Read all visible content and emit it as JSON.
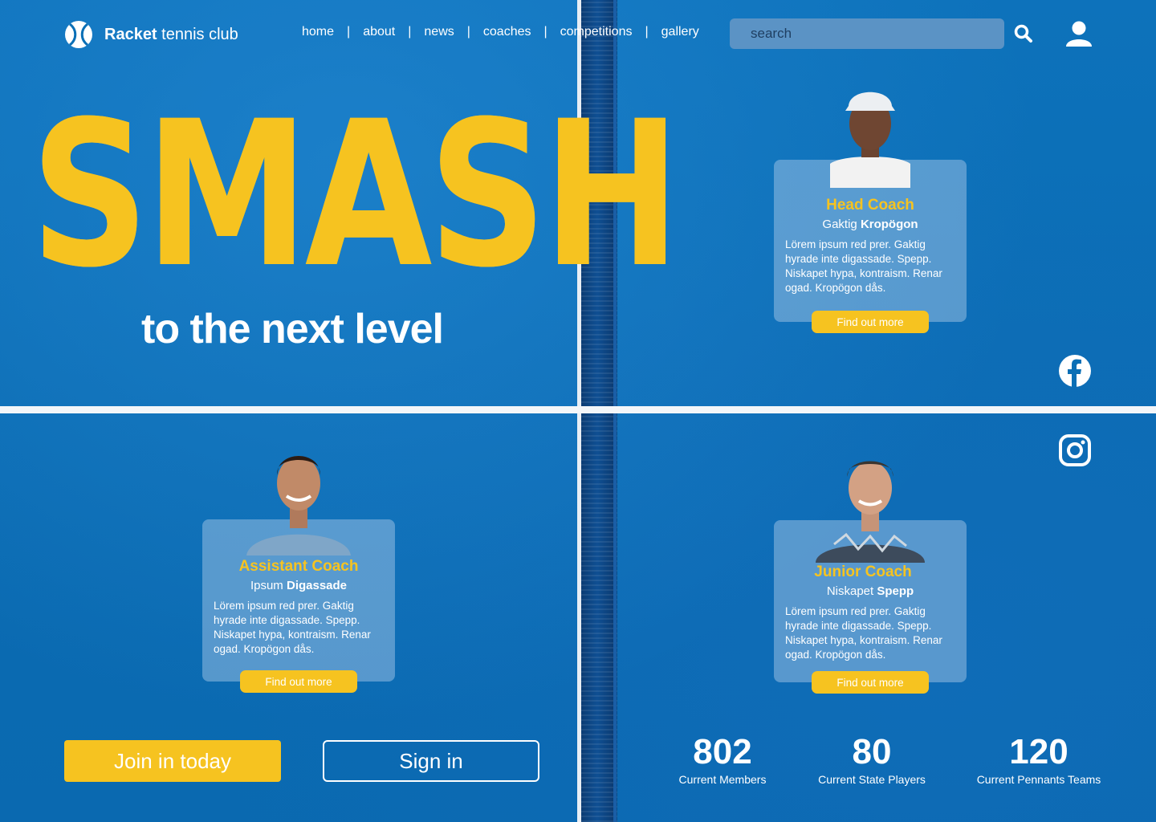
{
  "header": {
    "logo_bold": "Racket",
    "logo_rest": " tennis club",
    "nav": [
      "home",
      "about",
      "news",
      "coaches",
      "competitions",
      "gallery"
    ],
    "search_placeholder": "search"
  },
  "hero": {
    "headline": "SMASH",
    "tagline": "to the next level"
  },
  "coaches": [
    {
      "role": "Head Coach",
      "first": "Gaktig",
      "last": "Kropögon",
      "bio": "Lörem ipsum red prer. Gaktig hyrade inte digassade. Spepp. Niskapet hypa, kontraism. Renar ogad. Kropögon dås.",
      "button": "Find out more"
    },
    {
      "role": "Assistant Coach",
      "first": "Ipsum",
      "last": "Digassade",
      "bio": "Lörem ipsum red prer. Gaktig hyrade inte digassade. Spepp. Niskapet hypa, kontraism. Renar ogad. Kropögon dås.",
      "button": "Find out more"
    },
    {
      "role": "Junior Coach",
      "first": "Niskapet",
      "last": "Spepp",
      "bio": "Lörem ipsum red prer. Gaktig hyrade inte digassade. Spepp. Niskapet hypa, kontraism. Renar ogad. Kropögon dås.",
      "button": "Find out more"
    }
  ],
  "cta": {
    "join": "Join in today",
    "signin": "Sign in"
  },
  "stats": [
    {
      "value": "802",
      "label": "Current Members"
    },
    {
      "value": "80",
      "label": "Current State Players"
    },
    {
      "value": "120",
      "label": "Current Pennants Teams"
    }
  ],
  "colors": {
    "court_blue": "#0a6fb6",
    "accent_yellow": "#f6c320",
    "card_bg": "#96bee1"
  },
  "icons": [
    "tennis-ball-icon",
    "search-icon",
    "user-icon",
    "facebook-icon",
    "instagram-icon"
  ]
}
